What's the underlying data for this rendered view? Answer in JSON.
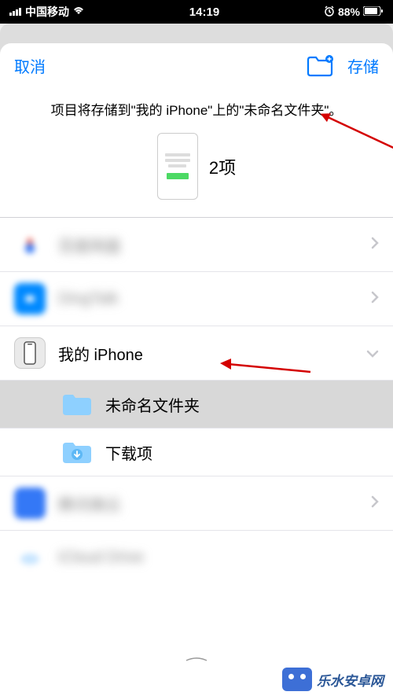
{
  "status_bar": {
    "signal_icon": "signal",
    "carrier": "中国移动",
    "wifi_icon": "wifi",
    "time": "14:19",
    "alarm_icon": "alarm",
    "battery_percent": "88%",
    "battery_icon": "battery"
  },
  "sheet": {
    "cancel_label": "取消",
    "new_folder_icon": "new-folder",
    "save_label": "存储",
    "description": "项目将存储到\"我的 iPhone\"上的\"未命名文件夹\"。",
    "items_count": "2项"
  },
  "locations": [
    {
      "label": "百度网盘",
      "blurred": true,
      "icon_color": "#ffffff",
      "icon_accent": "#e74c3c",
      "type": "app",
      "chevron": "right"
    },
    {
      "label": "DingTalk",
      "blurred": true,
      "icon_color": "#0089ff",
      "type": "app",
      "chevron": "right"
    },
    {
      "label": "我的 iPhone",
      "blurred": false,
      "icon_color": "#eaeaea",
      "type": "iphone",
      "chevron": "down"
    },
    {
      "label": "未命名文件夹",
      "blurred": false,
      "type": "folder",
      "folder_color": "#8ed0ff",
      "selected": true,
      "indent": true
    },
    {
      "label": "下载项",
      "blurred": false,
      "type": "folder",
      "folder_color": "#8ed0ff",
      "indent": true
    },
    {
      "label": "腾讯微云",
      "blurred": true,
      "icon_color": "#3478f6",
      "type": "app",
      "chevron": "right"
    },
    {
      "label": "iCloud Drive",
      "blurred": true,
      "icon_color": "#ffffff",
      "type": "cloud"
    }
  ],
  "watermark": {
    "text": "乐水安卓网"
  }
}
